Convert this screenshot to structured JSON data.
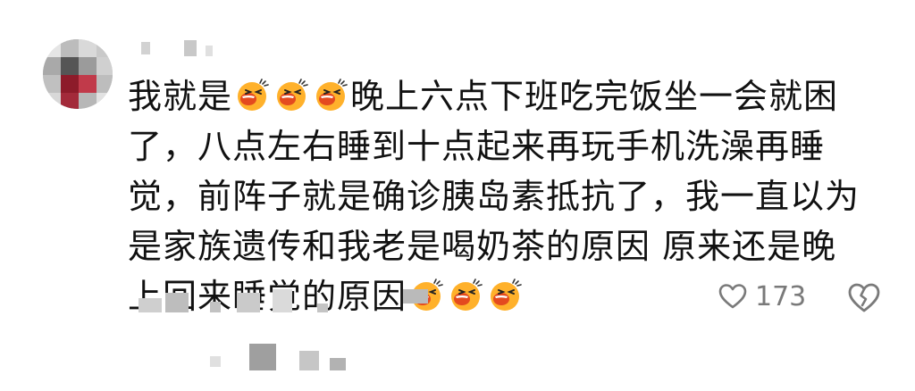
{
  "comment": {
    "segments": [
      {
        "type": "text",
        "value": "我就是"
      },
      {
        "type": "emoji",
        "icon": "laughing-crying-face"
      },
      {
        "type": "emoji",
        "icon": "laughing-crying-face"
      },
      {
        "type": "emoji",
        "icon": "laughing-crying-face"
      },
      {
        "type": "text",
        "value": "晚上六点下班吃完饭坐一会就困了，八点左右睡到十点起来再玩手机洗澡再睡觉，前阵子就是确诊胰岛素抵抗了，我一直以为是家族遗传和我老是喝奶茶的原因 原来还是晚上回来睡觉的原因"
      },
      {
        "type": "emoji",
        "icon": "laughing-crying-face"
      },
      {
        "type": "emoji",
        "icon": "laughing-crying-face"
      },
      {
        "type": "emoji",
        "icon": "laughing-crying-face"
      }
    ]
  },
  "actions": {
    "like_icon": "heart-outline-icon",
    "like_count": "173",
    "dislike_icon": "broken-heart-outline-icon"
  },
  "colors": {
    "text": "#111111",
    "meta": "#7a7a7a",
    "emoji_face": "#ffb12b",
    "emoji_mouth": "#e44a1f",
    "background": "#ffffff"
  }
}
